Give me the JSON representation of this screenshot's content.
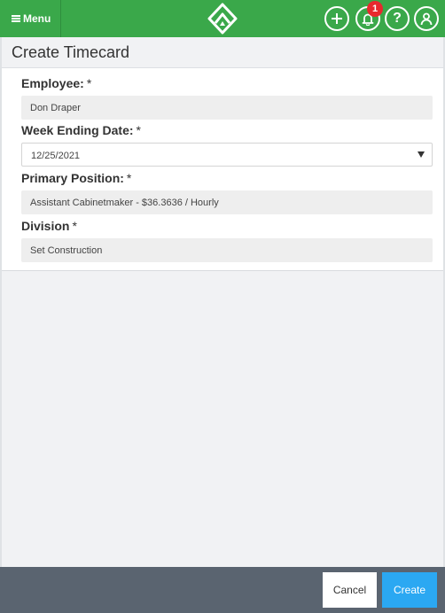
{
  "topbar": {
    "menu_label": "Menu",
    "notification_count": "1",
    "help_symbol": "?",
    "icons": [
      "hamburger-icon",
      "logo-icon",
      "plus-icon",
      "bell-icon",
      "help-icon",
      "user-icon"
    ],
    "colors": {
      "bar": "#3aa84a",
      "badge": "#e8292e"
    }
  },
  "page": {
    "title": "Create Timecard"
  },
  "form": {
    "required_mark": "*",
    "employee": {
      "label": "Employee:",
      "value": "Don Draper"
    },
    "week_ending": {
      "label": "Week Ending Date:",
      "value": "12/25/2021"
    },
    "position": {
      "label": "Primary Position:",
      "value": "Assistant Cabinetmaker - $36.3636 / Hourly"
    },
    "division": {
      "label": "Division",
      "value": "Set Construction"
    }
  },
  "footer": {
    "cancel_label": "Cancel",
    "create_label": "Create",
    "colors": {
      "footer": "#5a6470",
      "create": "#2ba8f2"
    }
  }
}
